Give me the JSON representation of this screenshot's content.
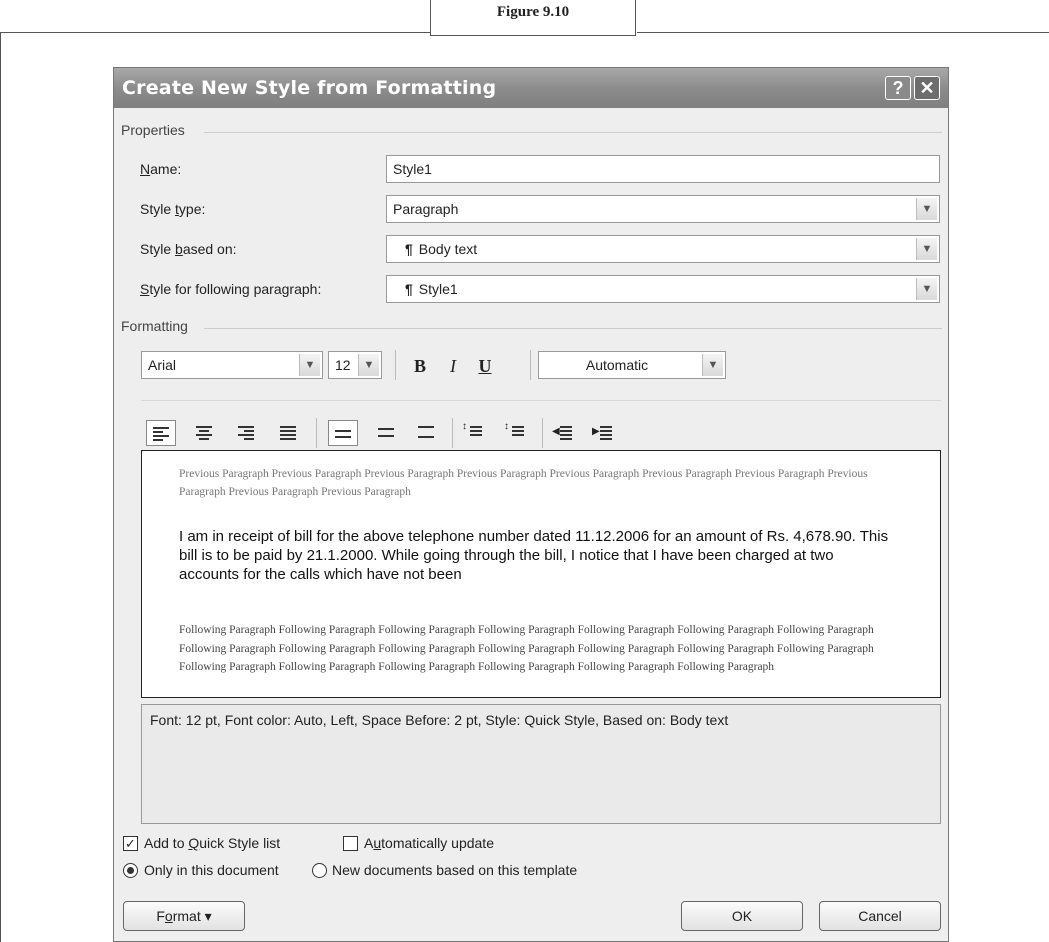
{
  "figure_caption": "Figure 9.10",
  "dialog": {
    "title": "Create New Style from Formatting",
    "help_glyph": "?",
    "close_glyph": "✕"
  },
  "properties": {
    "section_label": "Properties",
    "name": {
      "label_pre": "",
      "label_key": "N",
      "label_post": "ame:",
      "value": "Style1"
    },
    "style_type": {
      "label_pre": "Style ",
      "label_key": "t",
      "label_post": "ype:",
      "value": "Paragraph"
    },
    "style_based_on": {
      "label_pre": "Style ",
      "label_key": "b",
      "label_post": "ased on:",
      "value": "Body text"
    },
    "style_following": {
      "label_pre": "",
      "label_key": "S",
      "label_post": "tyle for following paragraph:",
      "value": "Style1"
    },
    "pilcrow": "¶"
  },
  "formatting": {
    "section_label": "Formatting",
    "font_name": "Arial",
    "font_size": "12",
    "bold": "B",
    "italic": "I",
    "underline": "U",
    "font_color": "Automatic"
  },
  "preview": {
    "previous_paragraph": "Previous Paragraph Previous Paragraph Previous Paragraph Previous Paragraph Previous Paragraph Previous Paragraph Previous Paragraph Previous Paragraph Previous Paragraph Previous Paragraph",
    "body_text": "I am in receipt of bill for the above telephone number dated 11.12.2006 for an amount of Rs. 4,678.90. This bill is to be paid by 21.1.2000. While going through the bill, I notice that I have been charged at two accounts for the calls which have not been",
    "following_paragraph": "Following Paragraph Following Paragraph Following Paragraph Following Paragraph Following Paragraph Following Paragraph Following Paragraph Following Paragraph Following Paragraph Following Paragraph Following Paragraph Following Paragraph Following Paragraph Following Paragraph Following Paragraph Following Paragraph Following Paragraph Following Paragraph Following Paragraph Following Paragraph"
  },
  "description": "Font: 12 pt, Font color: Auto, Left, Space Before:  2 pt, Style: Quick Style, Based on: Body text",
  "options": {
    "add_quick_style": {
      "pre": "Add to ",
      "key": "Q",
      "post": "uick Style list",
      "checked": true
    },
    "auto_update": {
      "pre": "A",
      "key": "u",
      "post": "tomatically update",
      "checked": false
    },
    "only_this_doc": {
      "label": "Only in this document",
      "selected": true
    },
    "new_docs": {
      "label": "New documents based on this template",
      "selected": false
    }
  },
  "buttons": {
    "format_pre": "F",
    "format_key": "o",
    "format_post": "rmat",
    "format_arrow": "▾",
    "ok": "OK",
    "cancel": "Cancel"
  }
}
